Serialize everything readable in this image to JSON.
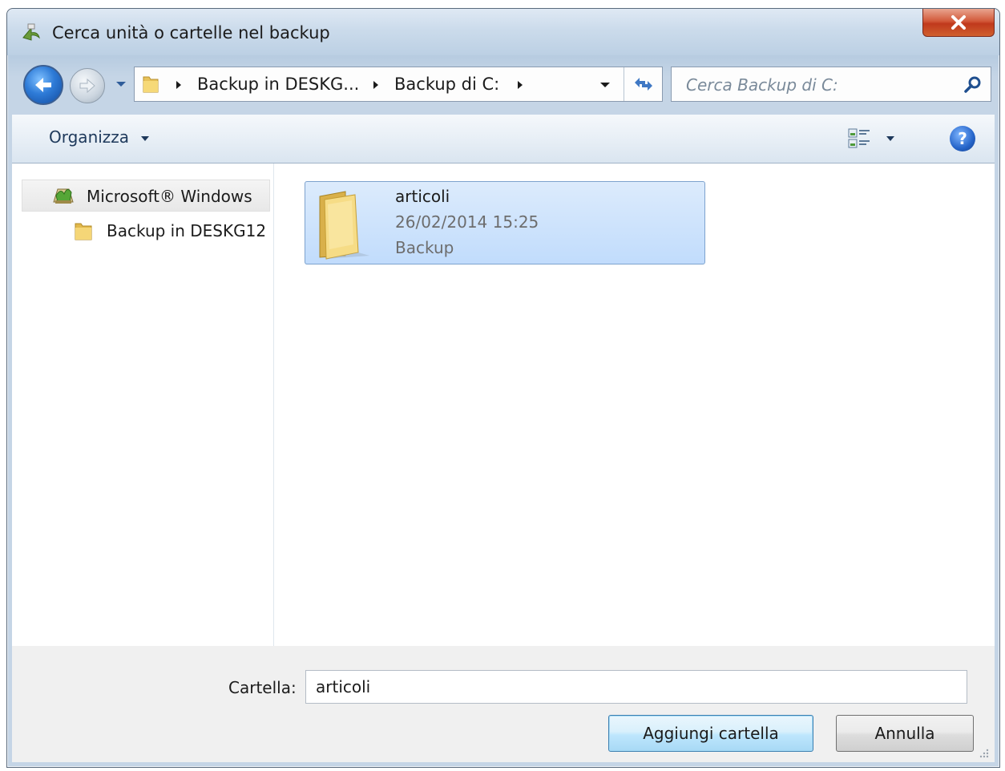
{
  "window": {
    "title": "Cerca unità o cartelle nel backup"
  },
  "address": {
    "crumbs": [
      "Backup in DESKG...",
      "Backup di C:"
    ]
  },
  "search": {
    "placeholder": "Cerca Backup di C:"
  },
  "toolbar": {
    "organize_label": "Organizza"
  },
  "nav_pane": {
    "items": [
      {
        "label": "Microsoft® Windows",
        "icon": "backup-icon"
      },
      {
        "label": "Backup in DESKG12",
        "icon": "folder-icon"
      }
    ]
  },
  "files": [
    {
      "name": "articoli",
      "date": "26/02/2014 15:25",
      "type": "Backup",
      "icon": "folder-icon"
    }
  ],
  "bottom": {
    "folder_label": "Cartella:",
    "folder_value": "articoli",
    "add_button": "Aggiungi cartella",
    "cancel_button": "Annulla"
  },
  "colors": {
    "selection": "#c1dcfc",
    "close_button": "#c0391c",
    "accent": "#2e7bd7"
  }
}
